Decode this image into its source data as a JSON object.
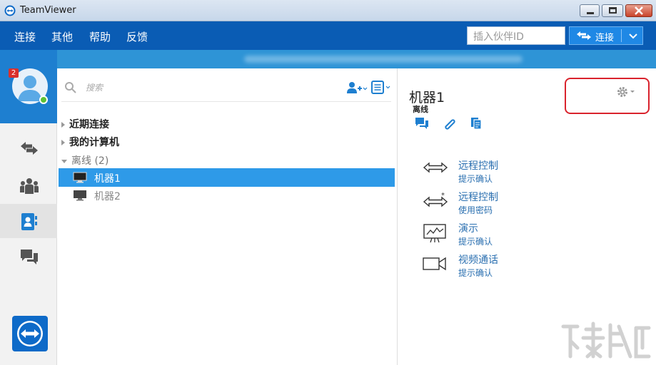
{
  "window": {
    "title": "TeamViewer"
  },
  "menu": {
    "items": [
      "连接",
      "其他",
      "帮助",
      "反馈"
    ],
    "partner_placeholder": "插入伙伴ID",
    "connect_label": "连接"
  },
  "sidebar": {
    "notification_count": "2",
    "items": [
      {
        "icon": "arrows-icon",
        "active": false
      },
      {
        "icon": "meeting-icon",
        "active": false
      },
      {
        "icon": "contacts-icon",
        "active": true
      },
      {
        "icon": "chat-icon",
        "active": false
      }
    ]
  },
  "list": {
    "search_placeholder": "搜索",
    "groups": [
      {
        "label": "近期连接",
        "expanded": false
      },
      {
        "label": "我的计算机",
        "expanded": false
      },
      {
        "label": "离线 (2)",
        "expanded": true
      }
    ],
    "computers": [
      {
        "name": "机器1",
        "selected": true
      },
      {
        "name": "机器2",
        "selected": false
      }
    ]
  },
  "detail": {
    "title": "机器1",
    "status": "离线",
    "actions": [
      {
        "icon": "remote-control-icon",
        "title": "远程控制",
        "sub": "提示确认"
      },
      {
        "icon": "remote-control-password-icon",
        "title": "远程控制",
        "sub": "使用密码"
      },
      {
        "icon": "presentation-icon",
        "title": "演示",
        "sub": "提示确认"
      },
      {
        "icon": "video-call-icon",
        "title": "视频通话",
        "sub": "提示确认"
      }
    ]
  },
  "colors": {
    "menubar": "#0a5cb4",
    "accent": "#1f88e5",
    "selection": "#2e9ae8",
    "link": "#2a6fb0",
    "highlight_box": "#d9232d"
  }
}
